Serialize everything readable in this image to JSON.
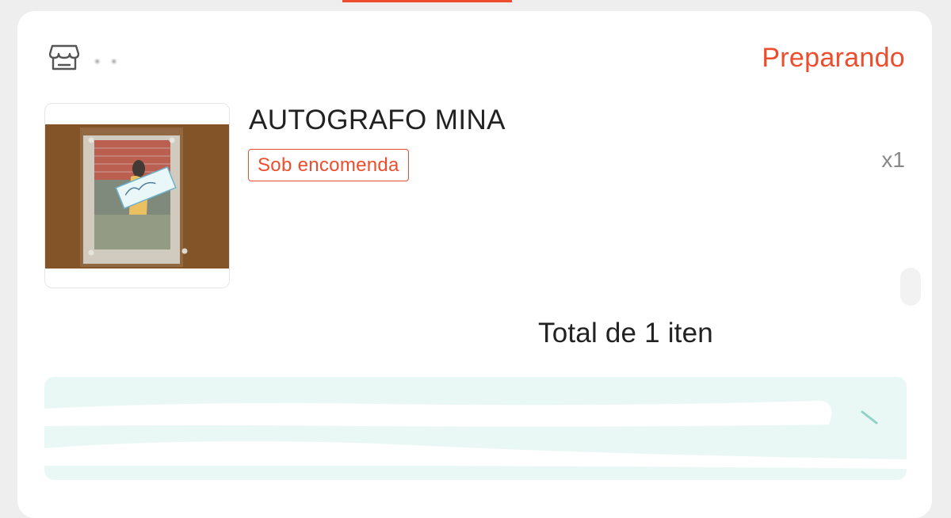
{
  "order": {
    "shop": {
      "icon": "store-icon",
      "name": "· ·"
    },
    "status": "Preparando",
    "item": {
      "image_icon": "product-photo",
      "name": "AUTOGRAFO MINA",
      "badge": "Sob encomenda",
      "quantity": "x1"
    },
    "total_text": "Total de 1 iten"
  },
  "colors": {
    "accent": "#ee4d2d",
    "quantity_text": "#888888",
    "info_background": "#eaf8f5"
  }
}
